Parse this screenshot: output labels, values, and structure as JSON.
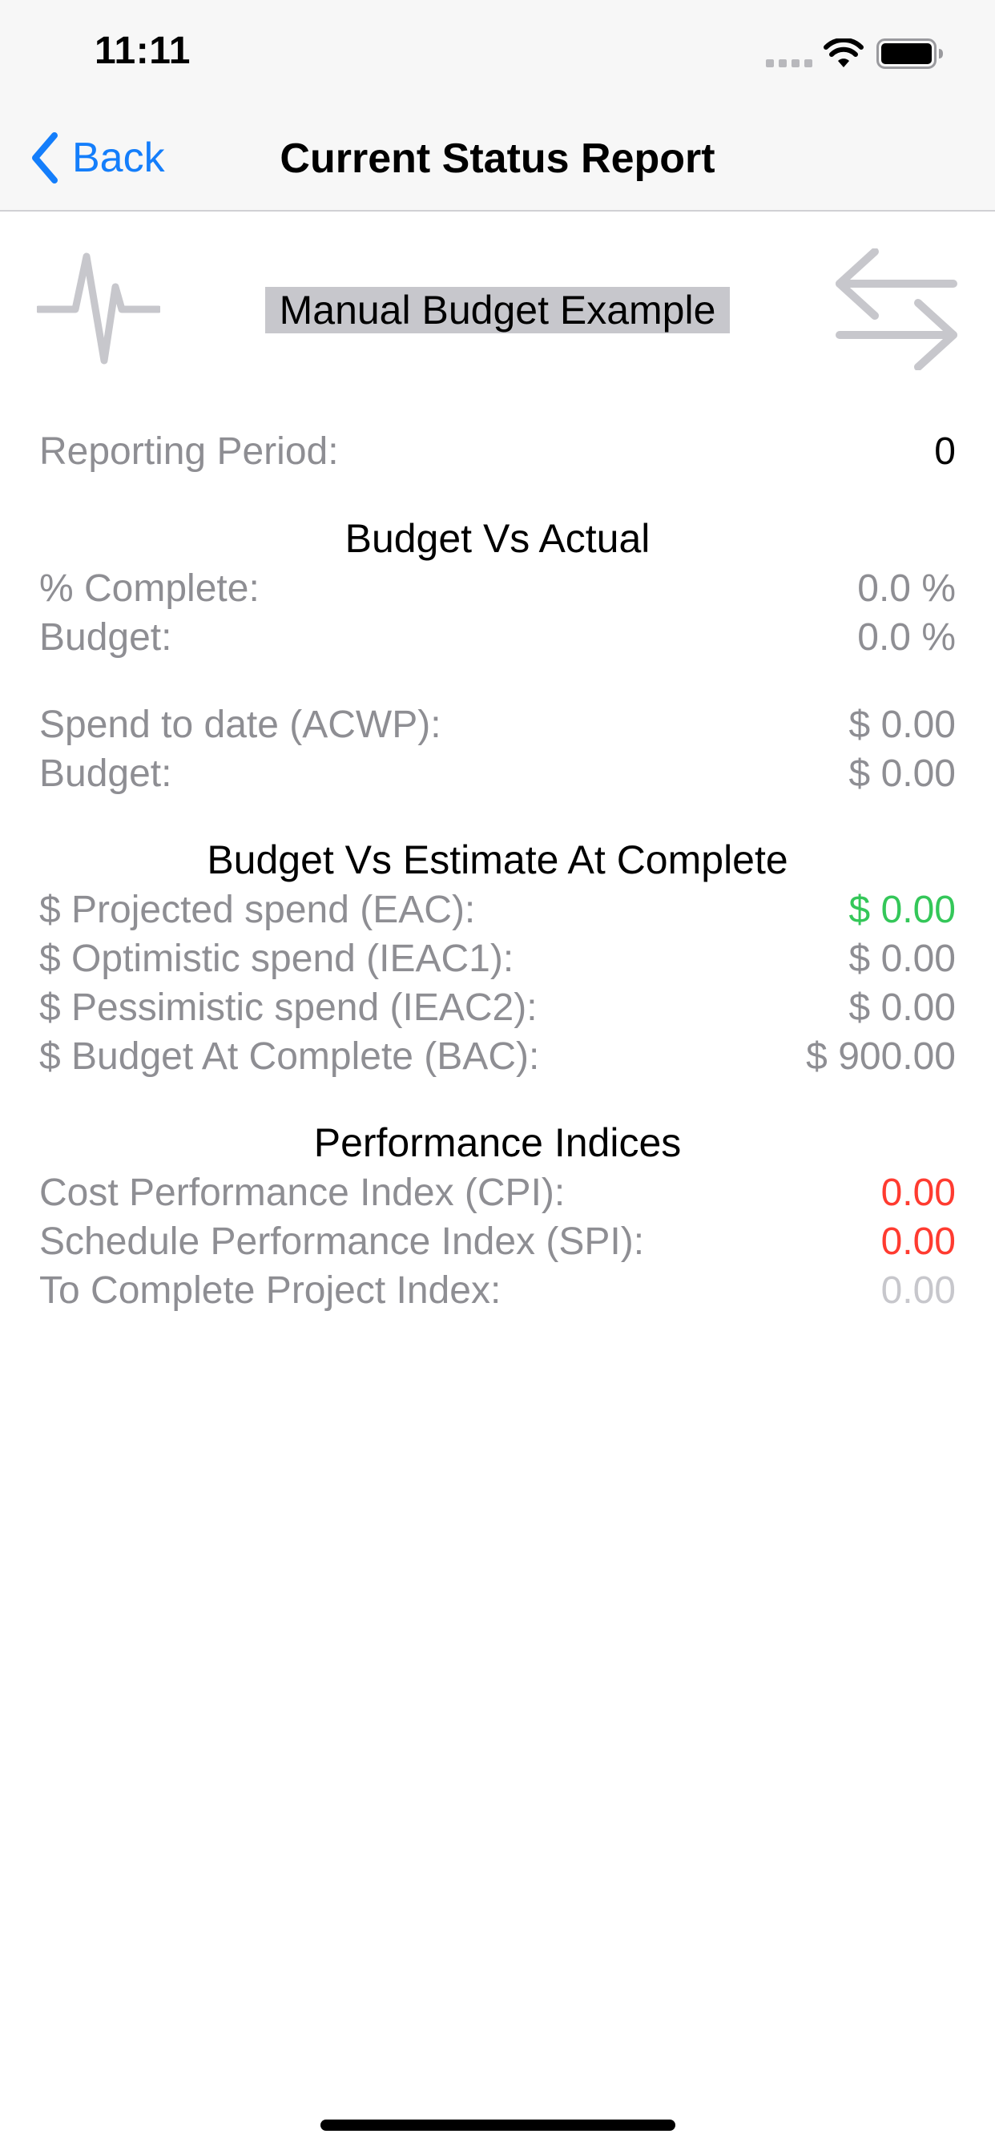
{
  "status_bar": {
    "time": "11:11"
  },
  "nav": {
    "back_label": "Back",
    "title": "Current Status Report"
  },
  "header": {
    "project_name": "Manual Budget Example",
    "left_icon": "pulse-icon",
    "right_icon": "swap-arrows-icon"
  },
  "reporting_period": {
    "label": "Reporting Period:",
    "value": "0"
  },
  "budget_vs_actual": {
    "title": "Budget Vs Actual",
    "rows": [
      {
        "label": "% Complete:",
        "value": "0.0 %"
      },
      {
        "label": "Budget:",
        "value": "0.0 %"
      },
      {
        "label": "Spend to date (ACWP):",
        "value": "$ 0.00"
      },
      {
        "label": "Budget:",
        "value": "$ 0.00"
      }
    ]
  },
  "budget_vs_eac": {
    "title": "Budget Vs Estimate At Complete",
    "rows": [
      {
        "label": "$ Projected spend (EAC):",
        "value": "$ 0.00"
      },
      {
        "label": "$ Optimistic spend (IEAC1):",
        "value": "$ 0.00"
      },
      {
        "label": "$ Pessimistic spend (IEAC2):",
        "value": "$ 0.00"
      },
      {
        "label": "$ Budget At Complete (BAC):",
        "value": "$ 900.00"
      }
    ]
  },
  "performance_indices": {
    "title": "Performance Indices",
    "rows": [
      {
        "label": "Cost Performance Index (CPI):",
        "value": "0.00"
      },
      {
        "label": "Schedule Performance Index (SPI):",
        "value": "0.00"
      },
      {
        "label": "To Complete Project Index:",
        "value": "0.00"
      }
    ]
  },
  "colors": {
    "accent_blue": "#147efb",
    "label_gray": "#8e8e93",
    "positive_green": "#34c759",
    "negative_red": "#ff3b30",
    "muted_gray": "#c7c7cc",
    "icon_gray": "#c7c7cc"
  }
}
